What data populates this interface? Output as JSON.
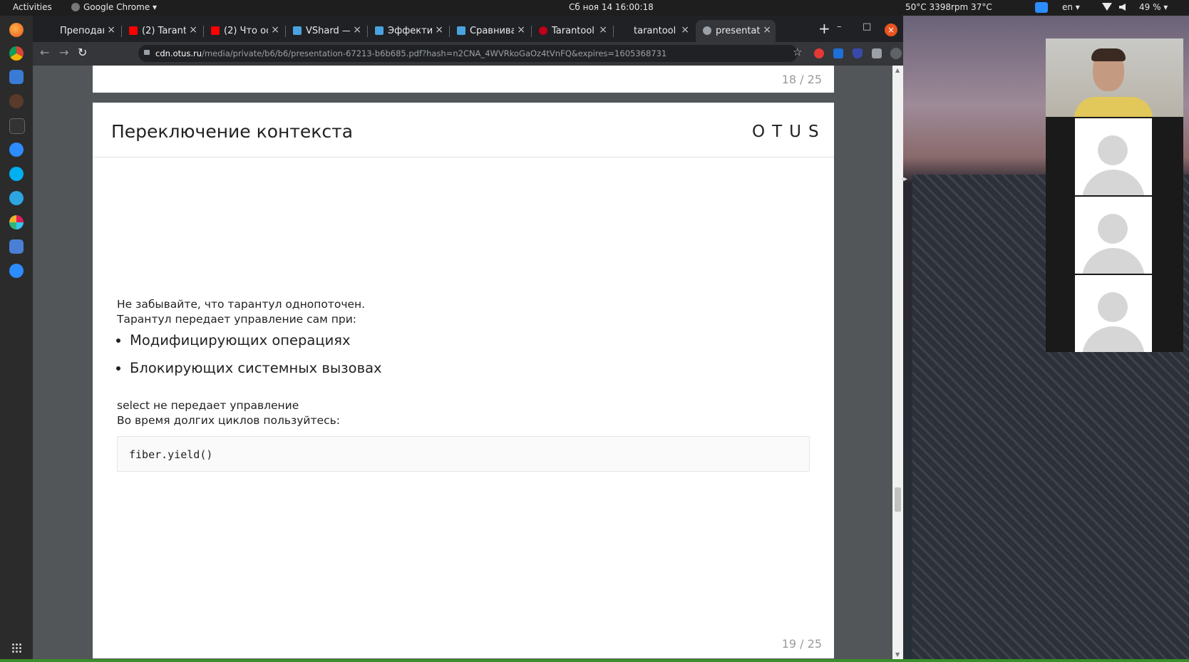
{
  "topbar": {
    "activities": "Activities",
    "app_name": "Google Chrome ▾",
    "clock": "Сб ноя 14 16:00:18",
    "status": "50°C  3398rpm  37°C",
    "lang": "en ▾",
    "battery": "49 % ▾"
  },
  "dock": {
    "items": [
      "firefox-icon",
      "chrome-icon",
      "notes-icon",
      "feather-icon",
      "terminal-icon",
      "zoom-icon",
      "skype-icon",
      "telegram-icon",
      "slack-icon",
      "calendar-icon",
      "zoom-meeting-icon",
      "apps-grid-icon"
    ]
  },
  "browser": {
    "tabs": [
      {
        "title": "Преподав",
        "favicon_color": "#202124"
      },
      {
        "title": "(2) Tarant",
        "favicon_color": "#ff0000"
      },
      {
        "title": "(2) Что ос",
        "favicon_color": "#ff0000"
      },
      {
        "title": "VShard — ",
        "favicon_color": "#4aa3df"
      },
      {
        "title": "Эффекти",
        "favicon_color": "#4aa3df"
      },
      {
        "title": "Сравнива",
        "favicon_color": "#4aa3df"
      },
      {
        "title": "Tarantool",
        "favicon_color": "#c0001a"
      },
      {
        "title": "tarantool",
        "favicon_color": "#202124"
      },
      {
        "title": "presentat",
        "favicon_color": "#9aa0a6"
      }
    ],
    "new_tab": "+",
    "url_host": "cdn.otus.ru",
    "url_rest": "/media/private/b6/b6/presentation-67213-b6b685.pdf?hash=n2CNA_4WVRkoGaOz4tVnFQ&expires=1605368731",
    "extension_colors": [
      "#e53935",
      "#1e6fd9",
      "#3949ab",
      "#9aa0a6",
      "#5f6368"
    ]
  },
  "pdf": {
    "prev_page_number": "18 / 25",
    "page_number": "19 / 25",
    "slide": {
      "title": "Переключение контекста",
      "logo": "OTUS",
      "intro_line1": "Не забывайте, что тарантул однопоточен.",
      "intro_line2": "Тарантул передает управление сам при:",
      "bullets": [
        "Модифицирующих операциях",
        "Блокирующих системных вызовах"
      ],
      "note_line1": "select не передает управление",
      "note_line2": "Во время долгих циклов пользуйтесь:",
      "code": "fiber.yield()"
    }
  },
  "zoom": {
    "participant_count": 3
  }
}
